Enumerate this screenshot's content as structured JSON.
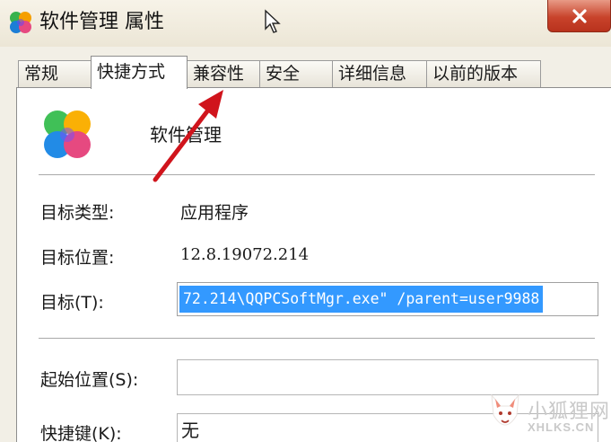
{
  "window": {
    "title": "软件管理 属性",
    "app_icon": "clover-app-icon",
    "close_icon": "close-icon"
  },
  "tabs": [
    {
      "label": "常规",
      "active": false
    },
    {
      "label": "快捷方式",
      "active": true
    },
    {
      "label": "兼容性",
      "active": false
    },
    {
      "label": "安全",
      "active": false
    },
    {
      "label": "详细信息",
      "active": false
    },
    {
      "label": "以前的版本",
      "active": false
    }
  ],
  "shortcut": {
    "app_name": "软件管理",
    "target_type_label": "目标类型:",
    "target_type_value": "应用程序",
    "target_location_label": "目标位置:",
    "target_location_value": "12.8.19072.214",
    "target_label": "目标(T):",
    "target_value": "72.214\\QQPCSoftMgr.exe\" /parent=user9988",
    "start_in_label": "起始位置(S):",
    "start_in_value": "",
    "hotkey_label": "快捷键(K):",
    "hotkey_value": "无"
  },
  "watermark": {
    "text_cn": "小狐狸网",
    "text_en": "XHLKS.CN"
  },
  "colors": {
    "selection": "#3399ff",
    "arrow": "#d0141c",
    "close_button": "#c8432b"
  }
}
